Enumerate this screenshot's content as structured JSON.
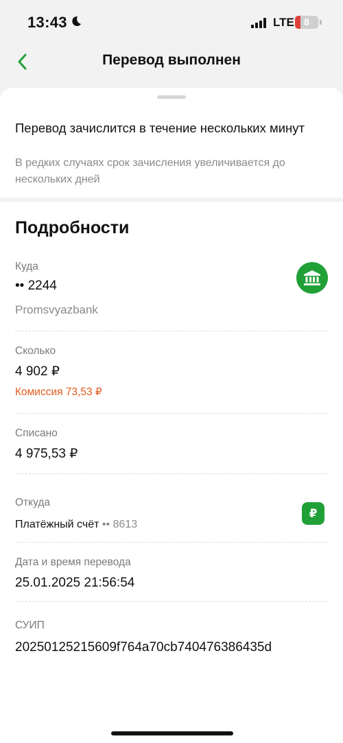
{
  "status_bar": {
    "time": "13:43",
    "network": "LTE",
    "battery": "8",
    "icons": [
      "moon-icon",
      "signal-icon",
      "battery-icon"
    ]
  },
  "nav": {
    "back_icon": "chevron-left-icon",
    "title": "Перевод выполнен"
  },
  "notice": {
    "title": "Перевод зачислится в течение нескольких минут",
    "subtitle": "В редких случаях срок зачисления увеличивается до нескольких дней"
  },
  "details": {
    "title": "Подробности",
    "to": {
      "label": "Куда",
      "card": "•• 2244",
      "bank": "Promsvyazbank",
      "icon": "bank-icon"
    },
    "amount": {
      "label": "Сколько",
      "value": "4 902 ₽",
      "commission": "Комиссия 73,53 ₽"
    },
    "debited": {
      "label": "Списано",
      "value": "4 975,53 ₽"
    },
    "from": {
      "label": "Откуда",
      "account_name": "Платёжный счёт",
      "account_mask": "•• 8613",
      "icon_text": "₽"
    },
    "datetime": {
      "label": "Дата и время перевода",
      "value": "25.01.2025 21:56:54"
    },
    "suip": {
      "label": "СУИП",
      "value": "20250125215609f764a70cb740476386435d"
    }
  },
  "colors": {
    "accent": "#21a038",
    "commission": "#e05a1c",
    "muted": "#8a8a8a"
  }
}
